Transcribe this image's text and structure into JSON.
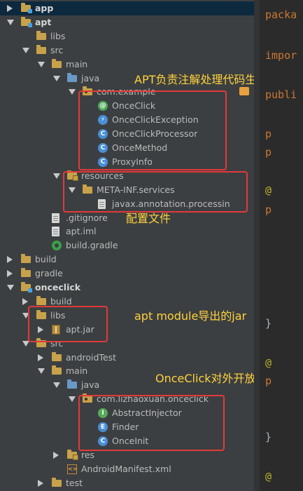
{
  "tree": {
    "rows": [
      {
        "label": "app",
        "depth": 0,
        "arrow": "right",
        "icon": "module-folder",
        "bold": true,
        "selected": true
      },
      {
        "label": "apt",
        "depth": 0,
        "arrow": "down",
        "icon": "module-folder",
        "bold": true
      },
      {
        "label": "libs",
        "depth": 1,
        "arrow": "none",
        "icon": "folder"
      },
      {
        "label": "src",
        "depth": 1,
        "arrow": "down",
        "icon": "folder"
      },
      {
        "label": "main",
        "depth": 2,
        "arrow": "down",
        "icon": "folder"
      },
      {
        "label": "java",
        "depth": 3,
        "arrow": "down",
        "icon": "source-folder"
      },
      {
        "label": "com.example",
        "depth": 4,
        "arrow": "down",
        "icon": "package"
      },
      {
        "label": "OnceClick",
        "depth": 5,
        "arrow": "none",
        "icon": "annotation",
        "glyph": "@"
      },
      {
        "label": "OnceClickException",
        "depth": 5,
        "arrow": "none",
        "icon": "exception-class",
        "glyph": "⚡"
      },
      {
        "label": "OnceClickProcessor",
        "depth": 5,
        "arrow": "none",
        "icon": "class",
        "glyph": "C"
      },
      {
        "label": "OnceMethod",
        "depth": 5,
        "arrow": "none",
        "icon": "class",
        "glyph": "C"
      },
      {
        "label": "ProxyInfo",
        "depth": 5,
        "arrow": "none",
        "icon": "class",
        "glyph": "C"
      },
      {
        "label": "resources",
        "depth": 3,
        "arrow": "down",
        "icon": "resources-folder"
      },
      {
        "label": "META-INF.services",
        "depth": 4,
        "arrow": "down",
        "icon": "folder"
      },
      {
        "label": "javax.annotation.processin",
        "depth": 5,
        "arrow": "none",
        "icon": "file"
      },
      {
        "label": ".gitignore",
        "depth": 2,
        "arrow": "none",
        "icon": "file"
      },
      {
        "label": "apt.iml",
        "depth": 2,
        "arrow": "none",
        "icon": "file"
      },
      {
        "label": "build.gradle",
        "depth": 2,
        "arrow": "none",
        "icon": "gradle"
      },
      {
        "label": "build",
        "depth": 0,
        "arrow": "right",
        "icon": "folder"
      },
      {
        "label": "gradle",
        "depth": 0,
        "arrow": "right",
        "icon": "folder"
      },
      {
        "label": "onceclick",
        "depth": 0,
        "arrow": "down",
        "icon": "module-folder",
        "bold": true
      },
      {
        "label": "build",
        "depth": 1,
        "arrow": "right",
        "icon": "folder"
      },
      {
        "label": "libs",
        "depth": 1,
        "arrow": "down",
        "icon": "folder"
      },
      {
        "label": "apt.jar",
        "depth": 2,
        "arrow": "right",
        "icon": "jar"
      },
      {
        "label": "src",
        "depth": 1,
        "arrow": "down",
        "icon": "folder"
      },
      {
        "label": "androidTest",
        "depth": 2,
        "arrow": "right",
        "icon": "folder"
      },
      {
        "label": "main",
        "depth": 2,
        "arrow": "down",
        "icon": "folder"
      },
      {
        "label": "java",
        "depth": 3,
        "arrow": "down",
        "icon": "source-folder"
      },
      {
        "label": "com.lizhaoxuan.onceclick",
        "depth": 4,
        "arrow": "down",
        "icon": "package"
      },
      {
        "label": "AbstractInjector",
        "depth": 5,
        "arrow": "none",
        "icon": "interface",
        "glyph": "I"
      },
      {
        "label": "Finder",
        "depth": 5,
        "arrow": "none",
        "icon": "enum",
        "glyph": "E"
      },
      {
        "label": "OnceInit",
        "depth": 5,
        "arrow": "none",
        "icon": "class",
        "glyph": "C"
      },
      {
        "label": "res",
        "depth": 3,
        "arrow": "right",
        "icon": "resources-folder"
      },
      {
        "label": "AndroidManifest.xml",
        "depth": 3,
        "arrow": "none",
        "icon": "xml",
        "glyph": "<>"
      },
      {
        "label": "test",
        "depth": 2,
        "arrow": "right",
        "icon": "folder"
      }
    ]
  },
  "annotations": {
    "apt_code_gen": "APT负责注解处理代码生成",
    "config_file": "配置文件",
    "apt_jar": "apt module导出的jar",
    "onceclick_api": "OnceClick对外开放的类"
  },
  "editor": {
    "lines": [
      {
        "text": "packa",
        "kind": "kw"
      },
      {
        "text": "impor",
        "kind": "kw"
      },
      {
        "text": "publi",
        "kind": "kw"
      },
      {
        "text": "p",
        "kind": "kw"
      },
      {
        "text": "p",
        "kind": "kw"
      },
      {
        "text": "@",
        "kind": "ann"
      },
      {
        "text": "p",
        "kind": "kw"
      },
      {
        "text": "}",
        "kind": "brace"
      },
      {
        "text": "@",
        "kind": "ann"
      },
      {
        "text": "p",
        "kind": "kw"
      },
      {
        "text": "}",
        "kind": "brace"
      },
      {
        "text": "@",
        "kind": "ann"
      }
    ]
  },
  "colors": {
    "annotation_box": "#e23a3a",
    "annotation_text": "#ffd23d",
    "panel_bg": "#3c3f41",
    "editor_bg": "#2b2b2b"
  }
}
